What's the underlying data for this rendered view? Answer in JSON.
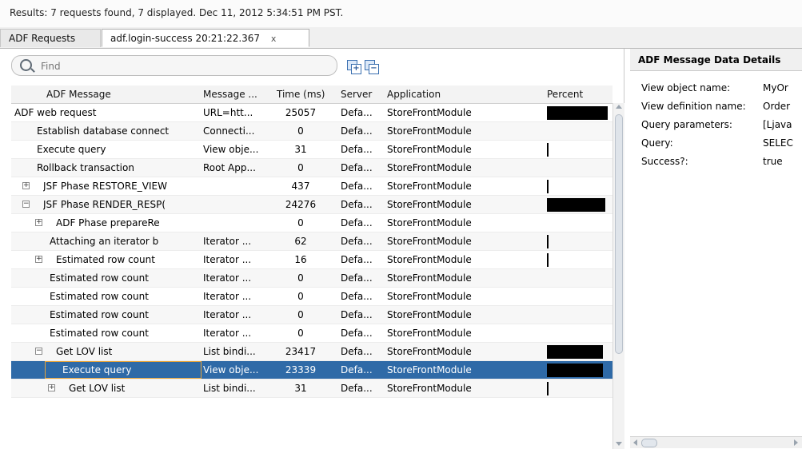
{
  "results_text": "Results:  7 requests found, 7 displayed.  Dec 11, 2012 5:34:51 PM PST.",
  "tabs": [
    {
      "label": "ADF Requests"
    },
    {
      "label": "adf.login-success  20:21:22.367",
      "close": "x"
    }
  ],
  "search": {
    "placeholder": "Find"
  },
  "toolbar": {
    "expand_all_icon": "expand-all-icon",
    "collapse_all_icon": "collapse-all-icon"
  },
  "columns": [
    "ADF Message",
    "Message ...",
    "Time (ms)",
    "Server",
    "Application",
    "Percent"
  ],
  "rows": [
    {
      "level": 0,
      "expander": "",
      "msg": "ADF web request",
      "type": "URL=htt...",
      "time": "25057",
      "server": "Defa...",
      "app": "StoreFrontModule",
      "percent": 0.55
    },
    {
      "level": 1,
      "expander": "",
      "msg": "Establish database connect",
      "type": "Connecti...",
      "time": "0",
      "server": "Defa...",
      "app": "StoreFrontModule",
      "percent": 0
    },
    {
      "level": 1,
      "expander": "",
      "msg": "Execute query",
      "type": "View obje...",
      "time": "31",
      "server": "Defa...",
      "app": "StoreFrontModule",
      "percent": 0.01
    },
    {
      "level": 1,
      "expander": "",
      "msg": "Rollback transaction",
      "type": "Root App...",
      "time": "0",
      "server": "Defa...",
      "app": "StoreFrontModule",
      "percent": 0
    },
    {
      "level": 1,
      "expander": "+",
      "msg": "JSF Phase RESTORE_VIEW",
      "type": "",
      "time": "437",
      "server": "Defa...",
      "app": "StoreFrontModule",
      "percent": 0.01
    },
    {
      "level": 1,
      "expander": "-",
      "msg": "JSF Phase RENDER_RESP(",
      "type": "",
      "time": "24276",
      "server": "Defa...",
      "app": "StoreFrontModule",
      "percent": 0.53
    },
    {
      "level": 2,
      "expander": "+",
      "msg": "ADF Phase prepareRe",
      "type": "",
      "time": "0",
      "server": "Defa...",
      "app": "StoreFrontModule",
      "percent": 0
    },
    {
      "level": 2,
      "expander": "",
      "msg": "Attaching an iterator b",
      "type": "Iterator ...",
      "time": "62",
      "server": "Defa...",
      "app": "StoreFrontModule",
      "percent": 0.01
    },
    {
      "level": 2,
      "expander": "+",
      "msg": "Estimated row count",
      "type": "Iterator ...",
      "time": "16",
      "server": "Defa...",
      "app": "StoreFrontModule",
      "percent": 0.01
    },
    {
      "level": 2,
      "expander": "",
      "msg": "Estimated row count",
      "type": "Iterator ...",
      "time": "0",
      "server": "Defa...",
      "app": "StoreFrontModule",
      "percent": 0
    },
    {
      "level": 2,
      "expander": "",
      "msg": "Estimated row count",
      "type": "Iterator ...",
      "time": "0",
      "server": "Defa...",
      "app": "StoreFrontModule",
      "percent": 0
    },
    {
      "level": 2,
      "expander": "",
      "msg": "Estimated row count",
      "type": "Iterator ...",
      "time": "0",
      "server": "Defa...",
      "app": "StoreFrontModule",
      "percent": 0
    },
    {
      "level": 2,
      "expander": "",
      "msg": "Estimated row count",
      "type": "Iterator ...",
      "time": "0",
      "server": "Defa...",
      "app": "StoreFrontModule",
      "percent": 0
    },
    {
      "level": 2,
      "expander": "-",
      "msg": "Get LOV list",
      "type": "List bindi...",
      "time": "23417",
      "server": "Defa...",
      "app": "StoreFrontModule",
      "percent": 0.51
    },
    {
      "level": 3,
      "expander": "",
      "msg": "Execute query",
      "type": "View obje...",
      "time": "23339",
      "server": "Defa...",
      "app": "StoreFrontModule",
      "percent": 0.51,
      "selected": true
    },
    {
      "level": 3,
      "expander": "+",
      "msg": "Get LOV list",
      "type": "List bindi...",
      "time": "31",
      "server": "Defa...",
      "app": "StoreFrontModule",
      "percent": 0.01
    }
  ],
  "details": {
    "title": "ADF Message Data Details",
    "items": [
      {
        "key": "View object name:",
        "value": "MyOr"
      },
      {
        "key": "View definition name:",
        "value": "Order"
      },
      {
        "key": "Query parameters:",
        "value": "[Ljava"
      },
      {
        "key": "Query:",
        "value": "SELEC"
      },
      {
        "key": "Success?:",
        "value": "true"
      }
    ]
  }
}
